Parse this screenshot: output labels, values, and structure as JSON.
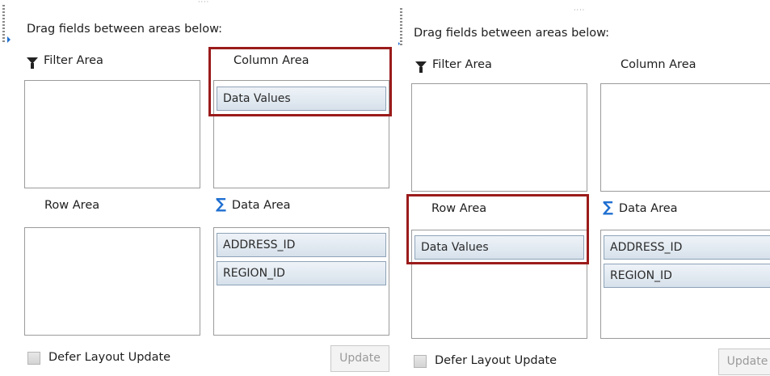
{
  "colors": {
    "highlight": "#9b1b1b",
    "chip_border": "#8ea3b8",
    "box_border": "#9b9b9b",
    "sigma": "#1f6fd1",
    "grid_gold": "#d9a21b",
    "grid_blue": "#6f8fb7"
  },
  "icons": {
    "filter": "funnel-icon",
    "column": "column-grid-icon",
    "row": "row-grid-icon",
    "data": "sigma-icon"
  },
  "left_panel": {
    "drag_label": "Drag fields between areas below:",
    "filter_area": {
      "title": "Filter Area",
      "fields": []
    },
    "column_area": {
      "title": "Column Area",
      "fields": [
        "Data Values"
      ],
      "highlighted": true
    },
    "row_area": {
      "title": "Row Area",
      "fields": []
    },
    "data_area": {
      "title": "Data Area",
      "fields": [
        "ADDRESS_ID",
        "REGION_ID"
      ]
    },
    "defer_label": "Defer Layout Update",
    "defer_checked": false,
    "update_label": "Update",
    "update_enabled": false
  },
  "right_panel": {
    "drag_label": "Drag fields between areas below:",
    "filter_area": {
      "title": "Filter Area",
      "fields": []
    },
    "column_area": {
      "title": "Column Area",
      "fields": []
    },
    "row_area": {
      "title": "Row Area",
      "fields": [
        "Data Values"
      ],
      "highlighted": true
    },
    "data_area": {
      "title": "Data Area",
      "fields": [
        "ADDRESS_ID",
        "REGION_ID"
      ]
    },
    "defer_label": "Defer Layout Update",
    "defer_checked": false,
    "update_label": "Update",
    "update_enabled": false
  }
}
